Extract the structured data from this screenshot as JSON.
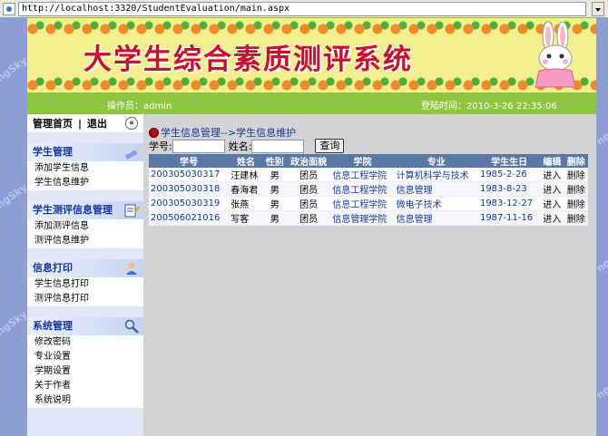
{
  "browser": {
    "address": "http://localhost:3320/StudentEvaluation/main.aspx"
  },
  "watermark": "ngSky",
  "banner": {
    "title": "大学生综合素质测评系统"
  },
  "status": {
    "operator": "操作员：admin",
    "login_time": "登陆时间：2010-3-26 22:35:06"
  },
  "sidebar": {
    "home": "管理首页",
    "separator": "|",
    "logout": "退出",
    "collapse": "«",
    "groups": [
      {
        "title": "学生管理",
        "items": [
          "添加学生信息",
          "学生信息维护"
        ]
      },
      {
        "title": "学生测评信息管理",
        "items": [
          "添加测评信息",
          "测评信息维护"
        ]
      },
      {
        "title": "信息打印",
        "items": [
          "学生信息打印",
          "测评信息打印"
        ]
      },
      {
        "title": "系统管理",
        "items": [
          "修改密码",
          "专业设置",
          "学期设置",
          "关于作者",
          "系统说明"
        ]
      }
    ]
  },
  "main": {
    "breadcrumb": "学生信息管理-->学生信息维护",
    "search": {
      "sid_label": "学号:",
      "sid_value": "",
      "name_label": "姓名:",
      "name_value": "",
      "button": "查询"
    },
    "table": {
      "headers": [
        "学号",
        "姓名",
        "性别",
        "政治面貌",
        "学院",
        "专业",
        "学生生日",
        "编辑",
        "删除"
      ],
      "rows": [
        [
          "200305030317",
          "汪建林",
          "男",
          "团员",
          "信息工程学院",
          "计算机科学与技术",
          "1985-2-26",
          "进入",
          "删除"
        ],
        [
          "200305030318",
          "春海君",
          "男",
          "团员",
          "信息工程学院",
          "信息管理",
          "1983-8-23",
          "进入",
          "删除"
        ],
        [
          "200305030319",
          "张燕",
          "男",
          "团员",
          "信息工程学院",
          "微电子技术",
          "1983-12-27",
          "进入",
          "删除"
        ],
        [
          "200506021016",
          "写客",
          "男",
          "团员",
          "信息管理学院",
          "信息管理",
          "1987-11-16",
          "进入",
          "删除"
        ]
      ]
    }
  },
  "colors": {
    "accent": "#8fc640",
    "header": "#5a78a6",
    "link": "#15379f",
    "title": "#c8102e"
  }
}
